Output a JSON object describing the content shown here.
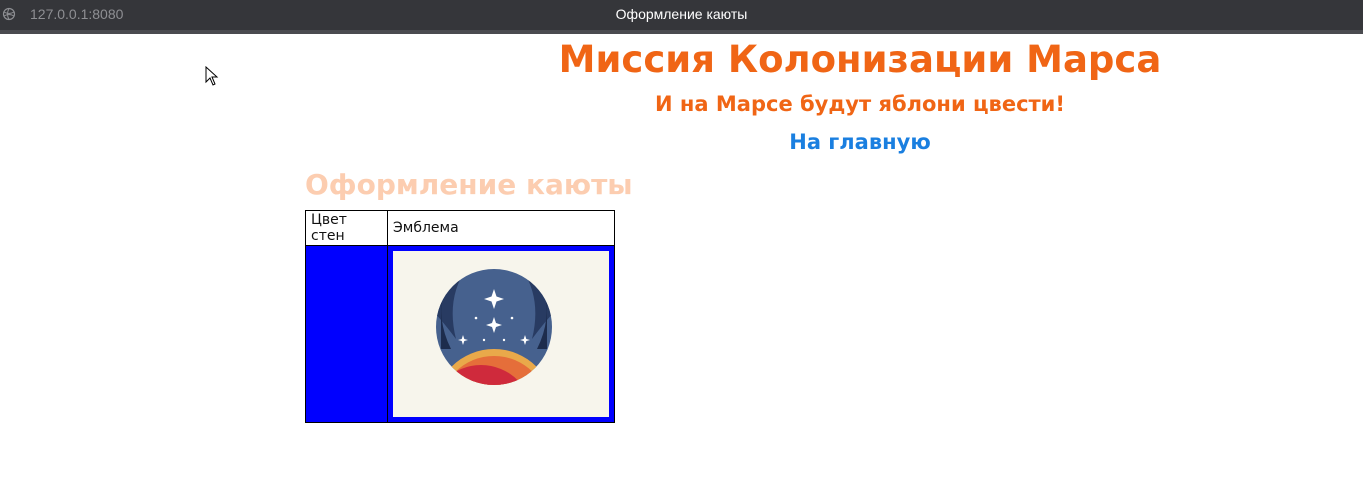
{
  "browser": {
    "url": "127.0.0.1:8080",
    "window_title": "Оформление каюты"
  },
  "header": {
    "title": "Миссия Колонизации Марса",
    "subtitle": "И на Марсе будут яблони цвести!",
    "home_link": "На главную"
  },
  "section": {
    "title": "Оформление каюты"
  },
  "table": {
    "columns": [
      "Цвет стен",
      "Эмблема"
    ],
    "wall_color": "#0000ff",
    "emblem_border_color": "#0000ff",
    "emblem_icon": "mission-emblem-icon"
  },
  "colors": {
    "title": "#f06515",
    "link": "#1a7fe0",
    "section_title": "#fccdb0"
  }
}
